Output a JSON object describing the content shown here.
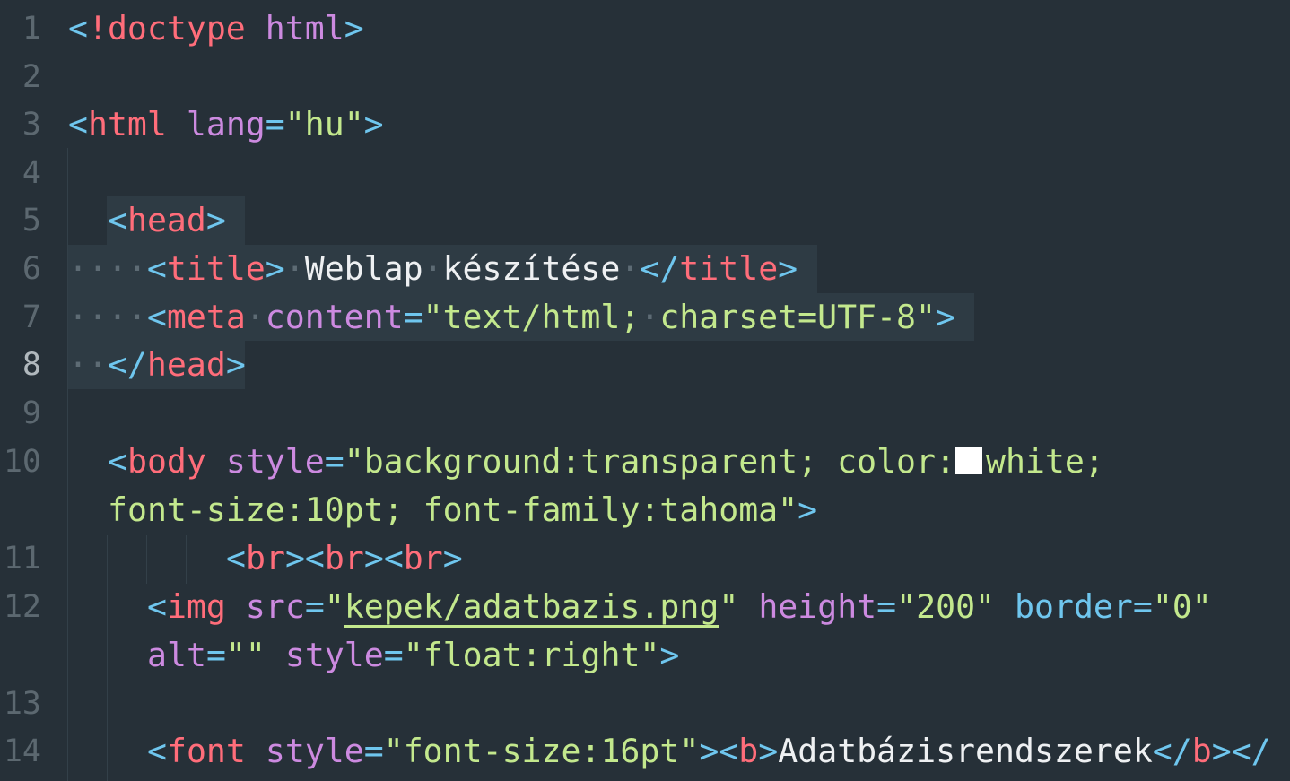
{
  "editor": {
    "language": "html",
    "line_numbers": [
      "1",
      "2",
      "3",
      "4",
      "5",
      "6",
      "7",
      "8",
      "9",
      "10",
      "11",
      "12",
      "13",
      "14"
    ],
    "active_line": "8",
    "lines": {
      "l1": [
        "<",
        "!doctype",
        " ",
        "html",
        ">"
      ],
      "l3": [
        "<",
        "html",
        " ",
        "lang",
        "=",
        "\"hu\"",
        ">"
      ],
      "l5": [
        "<",
        "head",
        ">"
      ],
      "l6": [
        "····",
        "<",
        "title",
        ">",
        "·",
        "Weblap",
        "·",
        "készítése",
        "·",
        "</",
        "title",
        ">"
      ],
      "l7": [
        "····",
        "<",
        "meta",
        "·",
        "content",
        "=",
        "\"text/html;",
        "·",
        "charset=UTF-8\"",
        ">"
      ],
      "l8": [
        "··",
        "</",
        "head",
        ">"
      ],
      "l10a": [
        "<",
        "body",
        " ",
        "style",
        "=",
        "\"background:transparent;",
        " ",
        "color:",
        "white;"
      ],
      "l10b": [
        "font-size:10pt;",
        " ",
        "font-family:tahoma\"",
        ">"
      ],
      "l11": [
        "<",
        "br",
        "><",
        "br",
        "><",
        "br",
        ">"
      ],
      "l12a": [
        "<",
        "img",
        " ",
        "src",
        "=",
        "\"",
        "kepek/adatbazis.png",
        "\"",
        " ",
        "height",
        "=",
        "\"200\"",
        " ",
        "border",
        "=",
        "\"0\""
      ],
      "l12b": [
        "alt",
        "=",
        "\"\"",
        " ",
        "style",
        "=",
        "\"float:right\"",
        ">"
      ],
      "l14": [
        "<",
        "font",
        " ",
        "style",
        "=",
        "\"font-size:16pt\"",
        "><",
        "b",
        ">",
        "Adatbázisrendszerek",
        "</",
        "b",
        "></"
      ]
    },
    "colors": {
      "background": "#263038",
      "punctuation": "#6fc6ee",
      "tag": "#ff6d7a",
      "attribute": "#cc8ae0",
      "string": "#c3e88d",
      "text": "#eef0f2",
      "whitespace_dots": "#5d6b74",
      "line_number": "#5c6870",
      "selection": "#2e3b44",
      "color_swatch": "#ffffff"
    }
  }
}
